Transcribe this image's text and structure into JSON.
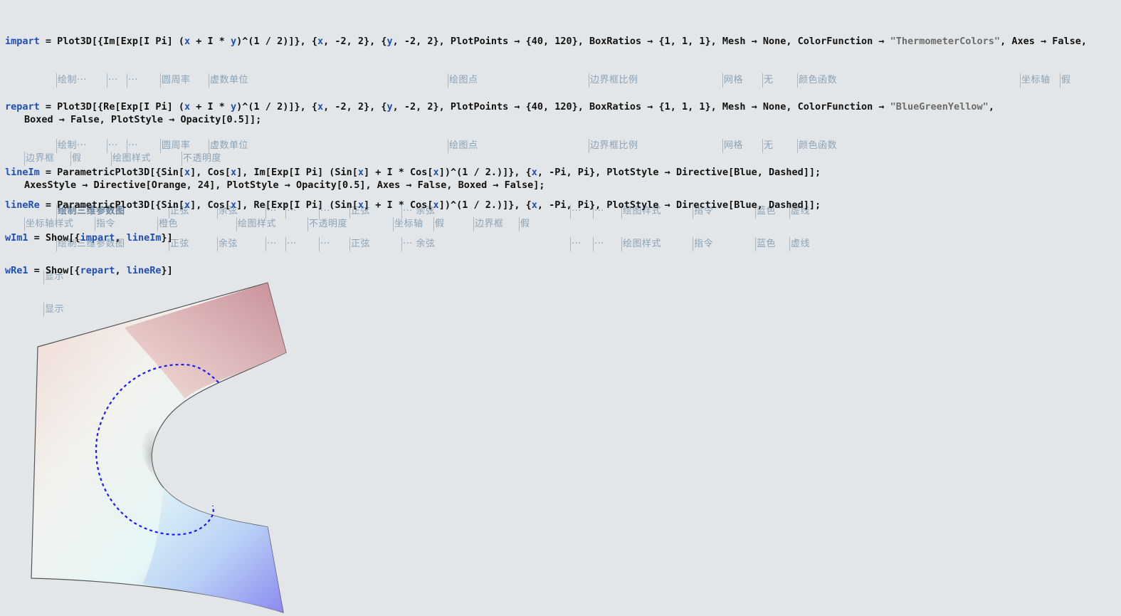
{
  "notebook": {
    "cells": [
      {
        "lines": [
          "impart = Plot3D[{Im[Exp[I Pi] (x + I * y)^(1 / 2)]}, {x, -2, 2}, {y, -2, 2}, PlotPoints → {40, 120}, BoxRatios → {1, 1, 1}, Mesh → None, ColorFunction → \"ThermometerColors\", Axes → False,",
          "Boxed → False, PlotStyle → Opacity[0.5]];"
        ],
        "hints_line1": [
          "绘制···",
          "···",
          "···",
          "",
          "圆周率",
          "虚数单位",
          "绘图点",
          "边界框比例",
          "网格",
          "无",
          "颜色函数",
          "坐标轴",
          "假"
        ],
        "hints_line2": [
          "边界框",
          "假",
          "绘图样式",
          "不透明度"
        ]
      },
      {
        "lines": [
          "repart = Plot3D[{Re[Exp[I Pi] (x + I * y)^(1 / 2)]}, {x, -2, 2}, {y, -2, 2}, PlotPoints → {40, 120}, BoxRatios → {1, 1, 1}, Mesh → None, ColorFunction → \"BlueGreenYellow\",",
          "AxesStyle → Directive[Orange, 24], PlotStyle → Opacity[0.5], Axes → False, Boxed → False];"
        ],
        "hints_line1": [
          "绘制···",
          "···",
          "···",
          "",
          "圆周率",
          "虚数单位",
          "绘图点",
          "边界框比例",
          "网格",
          "无",
          "颜色函数"
        ],
        "hints_line2": [
          "坐标轴样式",
          "指令",
          "橙色",
          "绘图样式",
          "不透明度",
          "坐标轴",
          "假",
          "边界框",
          "假"
        ]
      },
      {
        "lines": [
          "lineIm = ParametricPlot3D[{Sin[x], Cos[x], Im[Exp[I Pi] (Sin[x] + I * Cos[x])^(1 / 2.)]}, {x, -Pi, Pi}, PlotStyle → Directive[Blue, Dashed]];"
        ],
        "hints_line1": [
          "绘制三维参数图",
          "正弦",
          "余弦",
          "···",
          "···",
          "···",
          "正弦",
          "··· 余弦",
          "···",
          "···",
          "绘图样式",
          "指令",
          "蓝色",
          "虚线"
        ]
      },
      {
        "lines": [
          "lineRe = ParametricPlot3D[{Sin[x], Cos[x], Re[Exp[I Pi] (Sin[x] + I * Cos[x])^(1 / 2.)]}, {x, -Pi, Pi}, PlotStyle → Directive[Blue, Dashed]];"
        ],
        "hints_line1": [
          "绘制三维参数图",
          "正弦",
          "余弦",
          "···",
          "···",
          "···",
          "正弦",
          "··· 余弦",
          "···",
          "···",
          "绘图样式",
          "指令",
          "蓝色",
          "虚线"
        ]
      },
      {
        "lines": [
          "wIm1 = Show[{impart, lineIm}]"
        ],
        "hints_line1": [
          "显示"
        ]
      },
      {
        "lines": [
          "wRe1 = Show[{repart, lineRe}]"
        ],
        "hints_line1": [
          "显示"
        ]
      }
    ]
  },
  "colors": {
    "background": "#e3e6e8",
    "variable": "#1f4fb3",
    "string": "#6b6b6b",
    "hint": "#8aa3b8",
    "curve": "#1a1aff"
  }
}
